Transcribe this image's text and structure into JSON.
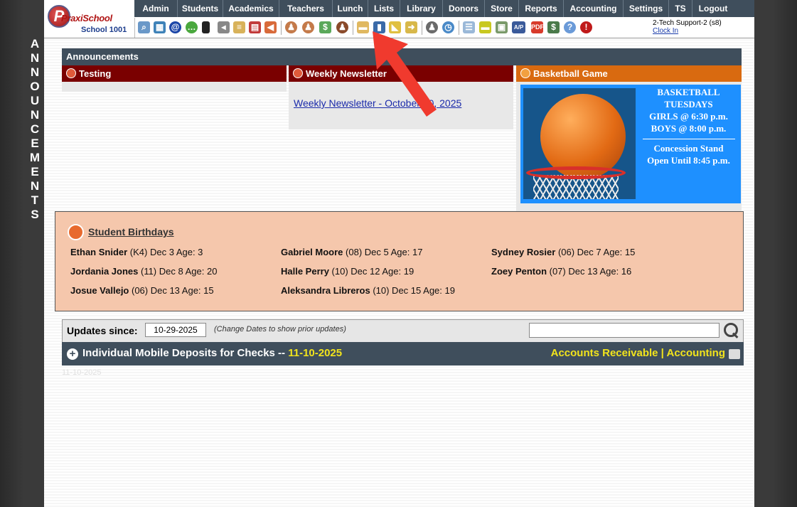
{
  "side_label": "ANNOUNCEMENTS",
  "logo": {
    "name": "PraxiSchool",
    "school": "School 1001",
    "initial": "P"
  },
  "nav": [
    "Admin",
    "Students",
    "Academics",
    "Teachers",
    "Lunch",
    "Lists",
    "Library",
    "Donors",
    "Store",
    "Reports",
    "Accounting",
    "Settings",
    "TS",
    "Logout"
  ],
  "user": {
    "name": "2-Tech Support-2 (s8)",
    "clock_in": "Clock In"
  },
  "toolbar_icons": [
    "search-icon",
    "grid-icon",
    "at-icon",
    "chat-icon",
    "phone-icon",
    "speaker-icon",
    "form-icon",
    "calendar-icon",
    "megaphone-icon",
    "person-icon",
    "person-icon",
    "money-icon",
    "users-icon",
    "lunch-icon",
    "book-icon",
    "bell-icon",
    "export-icon",
    "group-icon",
    "clock-icon",
    "list-icon",
    "card-icon",
    "printer-icon",
    "ap-icon",
    "pdf-icon",
    "cash-icon",
    "help-icon",
    "power-icon"
  ],
  "announcements": {
    "title": "Announcements",
    "panels": [
      {
        "title": "Testing",
        "color": "#7a0000"
      },
      {
        "title": "Weekly Newsletter",
        "color": "#7a0000",
        "link": "Weekly Newsletter - October 30, 2025"
      },
      {
        "title": "Basketball Game",
        "color": "#d96a10"
      }
    ],
    "basketball": {
      "line1": "BASKETBALL",
      "line2": "TUESDAYS",
      "line3": "GIRLS @ 6:30 p.m.",
      "line4": "BOYS  @ 8:00 p.m.",
      "line5": "Concession Stand",
      "line6": "Open Until 8:45 p.m."
    }
  },
  "birthdays": {
    "title": "Student Birthdays",
    "entries": [
      {
        "name": "Ethan Snider",
        "rest": " (K4) Dec 3 Age: 3"
      },
      {
        "name": "Gabriel Moore",
        "rest": " (08) Dec 5 Age: 17"
      },
      {
        "name": "Sydney Rosier",
        "rest": " (06) Dec 7 Age: 15"
      },
      {
        "name": "Jordania Jones",
        "rest": " (11) Dec 8 Age: 20"
      },
      {
        "name": "Halle Perry",
        "rest": " (10) Dec 12 Age: 19"
      },
      {
        "name": "Zoey Penton",
        "rest": " (07) Dec 13 Age: 16"
      },
      {
        "name": "Josue Vallejo",
        "rest": " (06) Dec 13 Age: 15"
      },
      {
        "name": "Aleksandra Libreros",
        "rest": " (10) Dec 15 Age: 19"
      }
    ]
  },
  "updates": {
    "label": "Updates since:",
    "date": "10-29-2025",
    "hint": "(Change Dates to show prior updates)",
    "search_value": ""
  },
  "deposits": {
    "title": "Individual Mobile Deposits for Checks -- ",
    "date": "11-10-2025",
    "link1": "Accounts Receivable",
    "sep": " | ",
    "link2": "Accounting"
  },
  "faint_text": "11-10-2025"
}
